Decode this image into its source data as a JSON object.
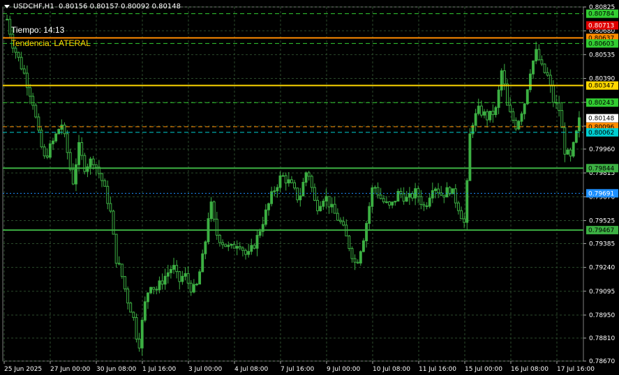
{
  "header": {
    "symbol": "USDCHF,H1",
    "ohlc": "0.80156 0.80157 0.80092 0.80148"
  },
  "overlay": {
    "time_text": "Tiempo: 14:13",
    "trend_text": "Tendencia: LATERAL"
  },
  "colors": {
    "background": "#000000",
    "candles": "#3cb043",
    "grid": "#2b4a2b",
    "axis_text": "#ffffff",
    "trend_text": "#ffd700"
  },
  "chart_data": {
    "type": "candlestick",
    "grid": true,
    "ylim": [
      0.7867,
      0.80825
    ],
    "y_ticks": [
      "0.80825",
      "0.80680",
      "0.80535",
      "0.80390",
      "0.80245",
      "0.80100",
      "0.79960",
      "0.79815",
      "0.79670",
      "0.79525",
      "0.79385",
      "0.79240",
      "0.79095",
      "0.78950",
      "0.78810",
      "0.78670"
    ],
    "x_ticks": [
      "25 Jun 2025",
      "27 Jun 00:00",
      "30 Jun 08:00",
      "1 Jul 16:00",
      "3 Jul 00:00",
      "4 Jul 08:00",
      "7 Jul 16:00",
      "9 Jul 00:00",
      "10 Jul 08:00",
      "11 Jul 16:00",
      "15 Jul 00:00",
      "16 Jul 08:00",
      "17 Jul 16:00"
    ],
    "current_price": 0.80148,
    "price_path": [
      [
        0,
        0.8075
      ],
      [
        0.01,
        0.806
      ],
      [
        0.03,
        0.8042
      ],
      [
        0.045,
        0.8025
      ],
      [
        0.055,
        0.8005
      ],
      [
        0.065,
        0.799
      ],
      [
        0.08,
        0.8
      ],
      [
        0.095,
        0.8012
      ],
      [
        0.105,
        0.7995
      ],
      [
        0.115,
        0.7975
      ],
      [
        0.125,
        0.7998
      ],
      [
        0.135,
        0.7985
      ],
      [
        0.15,
        0.799
      ],
      [
        0.165,
        0.7978
      ],
      [
        0.18,
        0.796
      ],
      [
        0.19,
        0.793
      ],
      [
        0.2,
        0.792
      ],
      [
        0.21,
        0.7905
      ],
      [
        0.22,
        0.7895
      ],
      [
        0.23,
        0.7875
      ],
      [
        0.24,
        0.79
      ],
      [
        0.25,
        0.7915
      ],
      [
        0.26,
        0.791
      ],
      [
        0.275,
        0.7918
      ],
      [
        0.29,
        0.7925
      ],
      [
        0.3,
        0.7915
      ],
      [
        0.31,
        0.792
      ],
      [
        0.32,
        0.7912
      ],
      [
        0.33,
        0.791
      ],
      [
        0.345,
        0.7935
      ],
      [
        0.355,
        0.7965
      ],
      [
        0.365,
        0.7945
      ],
      [
        0.375,
        0.794
      ],
      [
        0.39,
        0.7935
      ],
      [
        0.405,
        0.794
      ],
      [
        0.42,
        0.793
      ],
      [
        0.435,
        0.794
      ],
      [
        0.45,
        0.7955
      ],
      [
        0.465,
        0.797
      ],
      [
        0.48,
        0.798
      ],
      [
        0.495,
        0.7975
      ],
      [
        0.51,
        0.7965
      ],
      [
        0.525,
        0.7985
      ],
      [
        0.54,
        0.796
      ],
      [
        0.555,
        0.7968
      ],
      [
        0.57,
        0.7958
      ],
      [
        0.585,
        0.795
      ],
      [
        0.6,
        0.7935
      ],
      [
        0.61,
        0.7925
      ],
      [
        0.625,
        0.7945
      ],
      [
        0.64,
        0.7975
      ],
      [
        0.655,
        0.7965
      ],
      [
        0.67,
        0.796
      ],
      [
        0.685,
        0.797
      ],
      [
        0.7,
        0.7965
      ],
      [
        0.715,
        0.797
      ],
      [
        0.73,
        0.796
      ],
      [
        0.745,
        0.7975
      ],
      [
        0.76,
        0.7968
      ],
      [
        0.775,
        0.7972
      ],
      [
        0.79,
        0.796
      ],
      [
        0.8,
        0.795
      ],
      [
        0.81,
        0.801
      ],
      [
        0.825,
        0.802
      ],
      [
        0.84,
        0.8015
      ],
      [
        0.855,
        0.802
      ],
      [
        0.865,
        0.8045
      ],
      [
        0.875,
        0.802
      ],
      [
        0.89,
        0.801
      ],
      [
        0.905,
        0.8025
      ],
      [
        0.915,
        0.8045
      ],
      [
        0.925,
        0.8055
      ],
      [
        0.935,
        0.8045
      ],
      [
        0.945,
        0.804
      ],
      [
        0.955,
        0.8025
      ],
      [
        0.965,
        0.802
      ],
      [
        0.975,
        0.7995
      ],
      [
        0.985,
        0.799
      ],
      [
        1.0,
        0.8013
      ]
    ],
    "levels": [
      {
        "label": "0.80784",
        "value": 0.80784,
        "color": "#32cd32",
        "style": "dash",
        "tag_bg": "#32cd32",
        "tag_fg": "#000"
      },
      {
        "label": "0.80713",
        "value": 0.80713,
        "color": "#e00000",
        "style": "none",
        "tag_bg": "#e00000",
        "tag_fg": "#fff"
      },
      {
        "label": "0.80637",
        "value": 0.80637,
        "color": "#ff8c00",
        "style": "solid",
        "tag_bg": "#ff8c00",
        "tag_fg": "#000"
      },
      {
        "label": "0.80603",
        "value": 0.80603,
        "color": "#32cd32",
        "style": "dash",
        "tag_bg": "#32cd32",
        "tag_fg": "#000"
      },
      {
        "label": "0.80347",
        "value": 0.80347,
        "color": "#ffd700",
        "style": "solid",
        "tag_bg": "#ffd700",
        "tag_fg": "#000"
      },
      {
        "label": "0.80243",
        "value": 0.80243,
        "color": "#32cd32",
        "style": "dash",
        "tag_bg": "#32cd32",
        "tag_fg": "#000"
      },
      {
        "label": "0.80148",
        "value": 0.80148,
        "color": "#000000",
        "style": "none",
        "tag_bg": "#ffffff",
        "tag_fg": "#000"
      },
      {
        "label": "0.80096",
        "value": 0.80096,
        "color": "#ff8c00",
        "style": "dash",
        "tag_bg": "#ff8c00",
        "tag_fg": "#000"
      },
      {
        "label": "0.80062",
        "value": 0.80062,
        "color": "#00ced1",
        "style": "dash",
        "tag_bg": "#00ced1",
        "tag_fg": "#000"
      },
      {
        "label": "0.79844",
        "value": 0.79844,
        "color": "#3cb043",
        "style": "solid",
        "tag_bg": "#3cb043",
        "tag_fg": "#000"
      },
      {
        "label": "0.79691",
        "value": 0.79691,
        "color": "#1e90ff",
        "style": "dot",
        "tag_bg": "#1e90ff",
        "tag_fg": "#fff"
      },
      {
        "label": "0.79467",
        "value": 0.79467,
        "color": "#3cb043",
        "style": "solid",
        "tag_bg": "#3cb043",
        "tag_fg": "#000"
      }
    ]
  }
}
